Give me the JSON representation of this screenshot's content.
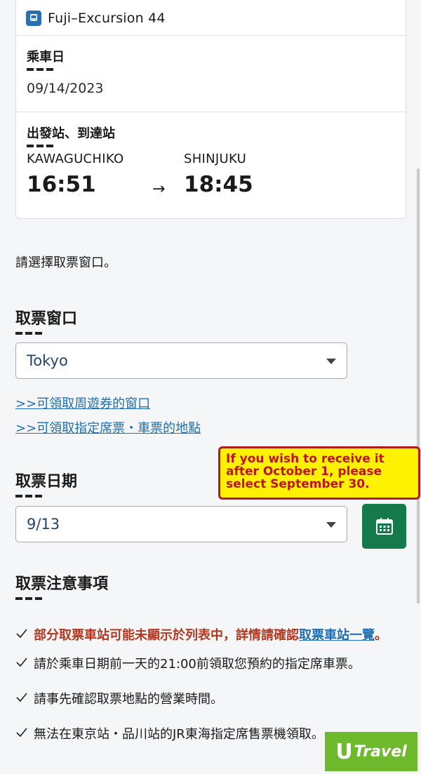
{
  "train": {
    "name": "Fuji–Excursion 44"
  },
  "boarding": {
    "label": "乘車日",
    "date": "09/14/2023"
  },
  "route": {
    "label": "出發站、到達站",
    "origin": {
      "station": "KAWAGUCHIKO",
      "time": "16:51"
    },
    "arrow": "→",
    "destination": {
      "station": "SHINJUKU",
      "time": "18:45"
    }
  },
  "instruction": "請選擇取票窗口。",
  "pickup_window": {
    "heading": "取票窗口",
    "selected": "Tokyo",
    "links": [
      ">>可領取周遊券的窗口",
      ">>可領取指定席票・車票的地點"
    ]
  },
  "pickup_date": {
    "heading": "取票日期",
    "selected": "9/13",
    "calendar_icon": "calendar-icon"
  },
  "annotation": {
    "text": "If you wish to receive it after October 1, please select September 30."
  },
  "notes": {
    "heading": "取票注意事項",
    "items": [
      {
        "text": "部分取票車站可能未顯示於列表中，詳情請確認",
        "link": "取票車站一覽",
        "suffix": "。"
      },
      {
        "text": "請於乘車日期前一天的21:00前領取您預約的指定席車票。"
      },
      {
        "text": "請事先確認取票地點的營業時間。"
      },
      {
        "text": "無法在東京站・品川站的JR東海指定席售票機領取。"
      }
    ]
  },
  "watermark": {
    "logo_letter": "U",
    "text": "Travel"
  },
  "colors": {
    "accent_green": "#147a4c",
    "link_blue": "#1f6fb2",
    "warning_red": "#b5371f",
    "highlight_yellow": "#fff200"
  }
}
